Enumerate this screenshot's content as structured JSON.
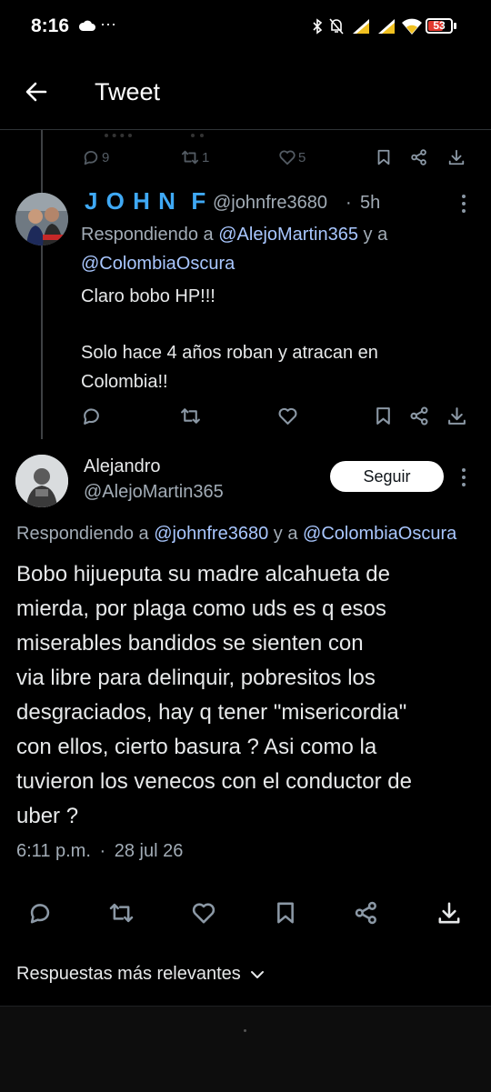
{
  "status": {
    "time": "8:16",
    "dots": "···",
    "battery": "53"
  },
  "header": {
    "title": "Tweet"
  },
  "prev_tweet": {
    "replies": "9",
    "retweets": "1",
    "likes": "5"
  },
  "reply_tweet": {
    "display_name": "J O H N  F",
    "handle": "@johnfre3680",
    "sep": "·",
    "time": "5h",
    "replying_prefix": "Respondiendo a",
    "replying_user1": "@AlejoMartin365",
    "replying_and": "y a",
    "replying_user2": "@ColombiaOscura",
    "text_line1": "Claro bobo HP!!!",
    "text_line2": "Solo hace 4 años roban y atracan en",
    "text_line3": "Colombia!!"
  },
  "main_tweet": {
    "display_name": "Alejandro",
    "handle": "@AlejoMartin365",
    "follow_label": "Seguir",
    "replying_prefix": "Respondiendo a",
    "replying_user1": "@johnfre3680",
    "replying_and": "y a",
    "replying_user2": "@ColombiaOscura",
    "lines": [
      "Bobo hijueputa su madre alcahueta de",
      "mierda, por plaga como uds es q esos",
      "miserables bandidos se sienten con",
      "via libre para delinquir, pobresitos los",
      "desgraciados, hay q tener \"misericordia\"",
      "con ellos, cierto basura ? Asi como la",
      "tuvieron los venecos con el conductor de",
      "uber ?"
    ],
    "time": "6:11 p.m.",
    "sep": "·",
    "date": "28 jul 26"
  },
  "sort": {
    "label": "Respuestas más relevantes"
  },
  "colors": {
    "background": "#000000",
    "link": "#a9c7ff",
    "name_accent": "#3fa9f5",
    "muted": "#a2acb6"
  }
}
